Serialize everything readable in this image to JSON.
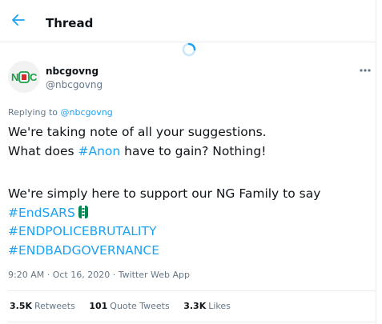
{
  "header": {
    "title": "Thread"
  },
  "tweet": {
    "name": "nbcgovng",
    "handle": "@nbcgovng",
    "avatar_text": "NBC",
    "replying_prefix": "Replying to",
    "replying_to": "@nbcgovng",
    "line1": "We're taking note of all your suggestions.",
    "line2_a": "What does ",
    "line2_tag": "#Anon",
    "line2_b": " have to gain? Nothing!",
    "line3": "We're simply here to support our NG Family to say",
    "tag1": "#EndSARS",
    "tag2": "#ENDPOLICEBRUTALITY",
    "tag3": "#ENDBADGOVERNANCE",
    "meta": "9:20 AM · Oct 16, 2020 · Twitter Web App"
  },
  "stats": {
    "retweets_count": "3.5K",
    "retweets_label": "Retweets",
    "quotes_count": "101",
    "quotes_label": "Quote Tweets",
    "likes_count": "3.3K",
    "likes_label": "Likes"
  },
  "colors": {
    "accent": "#1da1f2",
    "muted": "#657786",
    "border": "#e6ecf0",
    "flag_green": "#008751"
  },
  "icons": [
    "back-arrow-icon",
    "loading-spinner-icon",
    "more-options-icon",
    "nigeria-flag-emoji-icon"
  ]
}
